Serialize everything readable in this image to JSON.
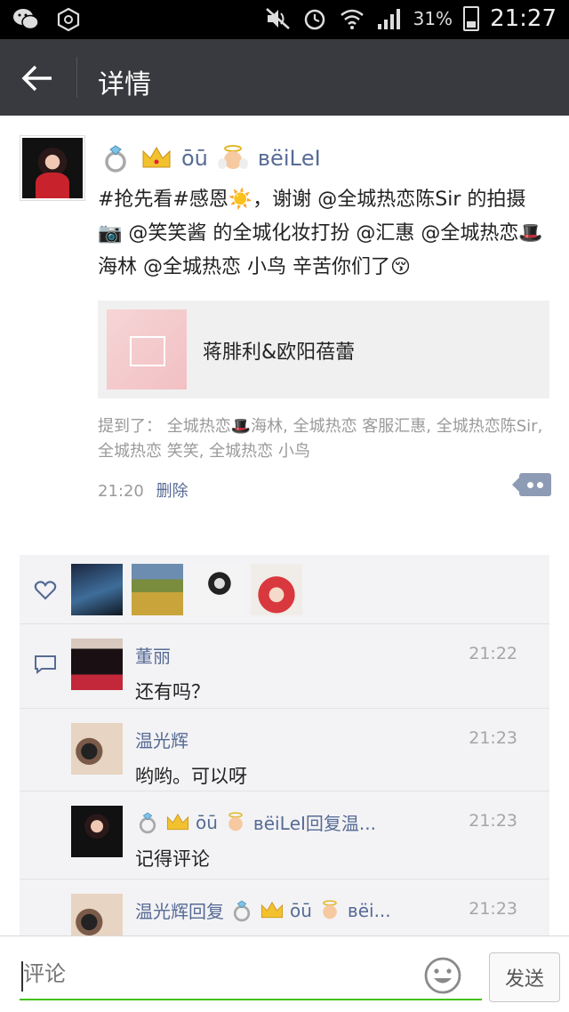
{
  "status_bar": {
    "battery_percent": "31%",
    "time": "21:27",
    "icons": [
      "wechat-icon",
      "notification-icon",
      "mute-icon",
      "alarm-icon",
      "wifi-icon",
      "signal-icon",
      "battery-icon"
    ]
  },
  "header": {
    "title": "详情"
  },
  "post": {
    "author_name": "ōū",
    "author_name_suffix": "вёiLеI",
    "text": "#抢先看#感恩☀️，谢谢 @全城热恋陈Sir 的拍摄📷 @笑笑酱  的全城化妆打扮 @汇惠  @全城热恋🎩海林 @全城热恋 小鸟 辛苦你们了😚",
    "link_card": {
      "title": "蒋腓利&欧阳蓓蕾"
    },
    "mentions": "提到了：  全城热恋🎩海林, 全城热恋 客服汇惠, 全城热恋陈Sir, 全城热恋 笑笑, 全城热恋 小鸟",
    "time": "21:20",
    "delete_label": "删除"
  },
  "likes": {
    "count_shown": 4
  },
  "comments": [
    {
      "name": "董丽",
      "time": "21:22",
      "text": "还有吗？"
    },
    {
      "name": "温光辉",
      "time": "21:23",
      "text": "哟哟。可以呀"
    },
    {
      "name_prefix": "ōū",
      "name_suffix": "вёiLеI回复温...",
      "time": "21:23",
      "text": "记得评论"
    },
    {
      "name": "温光辉回复",
      "name_tail": "ōū",
      "name_tail2": "вёi...",
      "time": "21:23",
      "text": ""
    }
  ],
  "input": {
    "placeholder": "评论",
    "send_label": "发送"
  },
  "colors": {
    "header_bg": "#393a3f",
    "link_blue": "#576b95",
    "accent_green": "#45c01a"
  }
}
